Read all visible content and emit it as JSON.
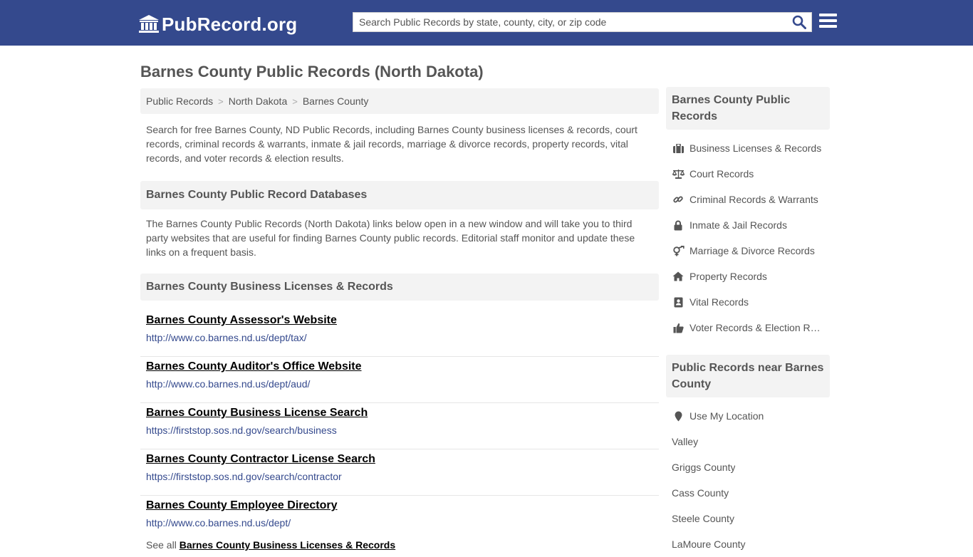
{
  "header": {
    "logo_text": "PubRecord.org",
    "search_placeholder": "Search Public Records by state, county, city, or zip code"
  },
  "page_title": "Barnes County Public Records (North Dakota)",
  "breadcrumb": [
    "Public Records",
    "North Dakota",
    "Barnes County"
  ],
  "intro": "Search for free Barnes County, ND Public Records, including Barnes County business licenses & records, court records, criminal records & warrants, inmate & jail records, marriage & divorce records, property records, vital records, and voter records & election results.",
  "databases": {
    "heading": "Barnes County Public Record Databases",
    "description": "The Barnes County Public Records (North Dakota) links below open in a new window and will take you to third party websites that are useful for finding Barnes County public records. Editorial staff monitor and update these links on a frequent basis."
  },
  "business": {
    "heading": "Barnes County Business Licenses & Records",
    "links": [
      {
        "title": "Barnes County Assessor's Website",
        "url": "http://www.co.barnes.nd.us/dept/tax/"
      },
      {
        "title": "Barnes County Auditor's Office Website",
        "url": "http://www.co.barnes.nd.us/dept/aud/"
      },
      {
        "title": "Barnes County Business License Search",
        "url": "https://firststop.sos.nd.gov/search/business"
      },
      {
        "title": "Barnes County Contractor License Search",
        "url": "https://firststop.sos.nd.gov/search/contractor"
      },
      {
        "title": "Barnes County Employee Directory",
        "url": "http://www.co.barnes.nd.us/dept/"
      }
    ],
    "see_all_prefix": "See all",
    "see_all_link": "Barnes County Business Licenses & Records"
  },
  "sidebar": {
    "records_heading": "Barnes County Public Records",
    "records": [
      {
        "label": "Business Licenses & Records",
        "icon": "briefcase-icon"
      },
      {
        "label": "Court Records",
        "icon": "scales-icon"
      },
      {
        "label": "Criminal Records & Warrants",
        "icon": "link-icon"
      },
      {
        "label": "Inmate & Jail Records",
        "icon": "lock-icon"
      },
      {
        "label": "Marriage & Divorce Records",
        "icon": "gender-icon"
      },
      {
        "label": "Property Records",
        "icon": "home-icon"
      },
      {
        "label": "Vital Records",
        "icon": "id-card-icon"
      },
      {
        "label": "Voter Records & Election R…",
        "icon": "thumbs-up-icon"
      }
    ],
    "near_heading": "Public Records near Barnes County",
    "use_location": "Use My Location",
    "near": [
      "Valley",
      "Griggs County",
      "Cass County",
      "Steele County",
      "LaMoure County"
    ]
  }
}
